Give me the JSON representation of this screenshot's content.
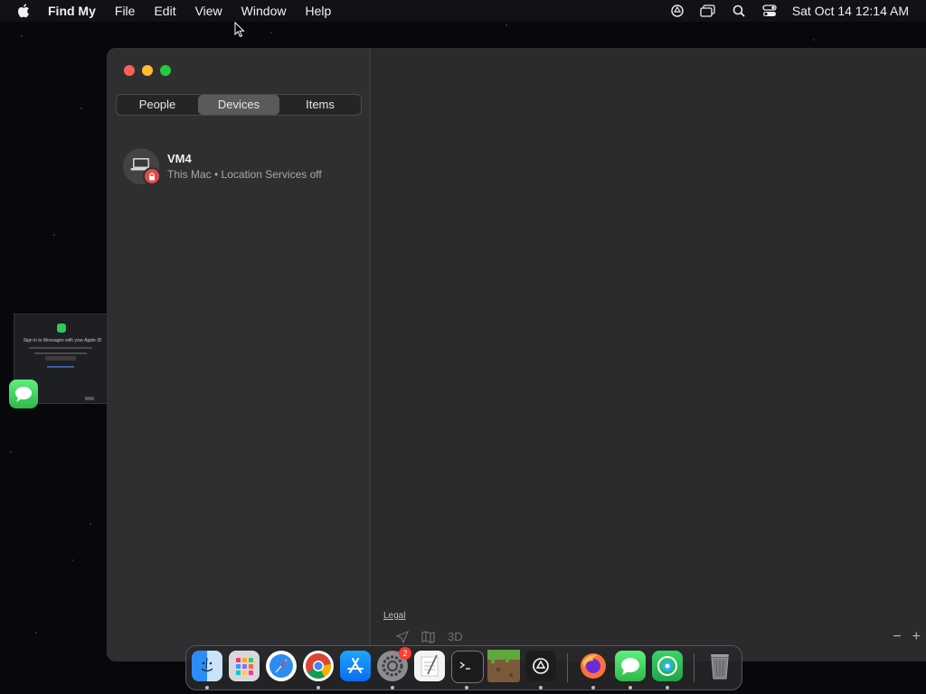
{
  "menubar": {
    "app_name": "Find My",
    "menus": [
      "File",
      "Edit",
      "View",
      "Window",
      "Help"
    ],
    "clock": "Sat Oct 14  12:14 AM"
  },
  "sidebar": {
    "segments": [
      "People",
      "Devices",
      "Items"
    ],
    "selected_segment": "Devices",
    "devices": [
      {
        "name": "VM4",
        "subtitle": "This Mac • Location Services off"
      }
    ]
  },
  "map": {
    "legal": "Legal",
    "mode_3d": "3D",
    "zoom_out": "−",
    "zoom_in": "+"
  },
  "thumbnail": {
    "title": "Sign in to Messages with your Apple ID"
  },
  "dock": {
    "system_settings_badge": "2"
  }
}
